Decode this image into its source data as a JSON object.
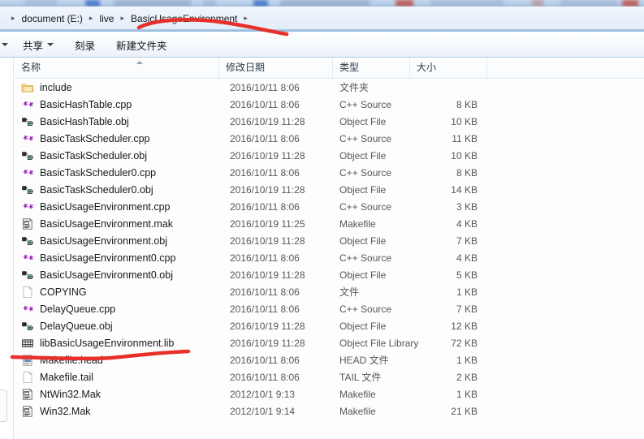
{
  "window": {
    "background_strip": "partially visible window behind"
  },
  "addressbar": {
    "crumbs": [
      "document (E:)",
      "live",
      "BasicUsageEnvironment"
    ],
    "separator": "▸",
    "trailing_separator": "▸"
  },
  "toolbar": {
    "leading_caret": "▾",
    "items": [
      {
        "label": "共享",
        "has_caret": true
      },
      {
        "label": "刻录",
        "has_caret": false
      },
      {
        "label": "新建文件夹",
        "has_caret": false
      }
    ]
  },
  "columns": {
    "name": "名称",
    "date": "修改日期",
    "type": "类型",
    "size": "大小"
  },
  "files": [
    {
      "name": "include",
      "date": "2016/10/11 8:06",
      "type": "文件夹",
      "size": "",
      "icon": "folder-icon"
    },
    {
      "name": "BasicHashTable.cpp",
      "date": "2016/10/11 8:06",
      "type": "C++ Source",
      "size": "8 KB",
      "icon": "cpp-source-icon"
    },
    {
      "name": "BasicHashTable.obj",
      "date": "2016/10/19 11:28",
      "type": "Object File",
      "size": "10 KB",
      "icon": "object-file-icon"
    },
    {
      "name": "BasicTaskScheduler.cpp",
      "date": "2016/10/11 8:06",
      "type": "C++ Source",
      "size": "11 KB",
      "icon": "cpp-source-icon"
    },
    {
      "name": "BasicTaskScheduler.obj",
      "date": "2016/10/19 11:28",
      "type": "Object File",
      "size": "10 KB",
      "icon": "object-file-icon"
    },
    {
      "name": "BasicTaskScheduler0.cpp",
      "date": "2016/10/11 8:06",
      "type": "C++ Source",
      "size": "8 KB",
      "icon": "cpp-source-icon"
    },
    {
      "name": "BasicTaskScheduler0.obj",
      "date": "2016/10/19 11:28",
      "type": "Object File",
      "size": "14 KB",
      "icon": "object-file-icon"
    },
    {
      "name": "BasicUsageEnvironment.cpp",
      "date": "2016/10/11 8:06",
      "type": "C++ Source",
      "size": "3 KB",
      "icon": "cpp-source-icon"
    },
    {
      "name": "BasicUsageEnvironment.mak",
      "date": "2016/10/19 11:25",
      "type": "Makefile",
      "size": "4 KB",
      "icon": "makefile-icon"
    },
    {
      "name": "BasicUsageEnvironment.obj",
      "date": "2016/10/19 11:28",
      "type": "Object File",
      "size": "7 KB",
      "icon": "object-file-icon"
    },
    {
      "name": "BasicUsageEnvironment0.cpp",
      "date": "2016/10/11 8:06",
      "type": "C++ Source",
      "size": "4 KB",
      "icon": "cpp-source-icon"
    },
    {
      "name": "BasicUsageEnvironment0.obj",
      "date": "2016/10/19 11:28",
      "type": "Object File",
      "size": "5 KB",
      "icon": "object-file-icon"
    },
    {
      "name": "COPYING",
      "date": "2016/10/11 8:06",
      "type": "文件",
      "size": "1 KB",
      "icon": "blank-file-icon"
    },
    {
      "name": "DelayQueue.cpp",
      "date": "2016/10/11 8:06",
      "type": "C++ Source",
      "size": "7 KB",
      "icon": "cpp-source-icon"
    },
    {
      "name": "DelayQueue.obj",
      "date": "2016/10/19 11:28",
      "type": "Object File",
      "size": "12 KB",
      "icon": "object-file-icon"
    },
    {
      "name": "libBasicUsageEnvironment.lib",
      "date": "2016/10/19 11:28",
      "type": "Object File Library",
      "size": "72 KB",
      "icon": "library-file-icon"
    },
    {
      "name": "Makefile.head",
      "date": "2016/10/11 8:06",
      "type": "HEAD 文件",
      "size": "1 KB",
      "icon": "head-file-icon"
    },
    {
      "name": "Makefile.tail",
      "date": "2016/10/11 8:06",
      "type": "TAIL 文件",
      "size": "2 KB",
      "icon": "blank-file-icon"
    },
    {
      "name": "NtWin32.Mak",
      "date": "2012/10/1 9:13",
      "type": "Makefile",
      "size": "1 KB",
      "icon": "makefile-icon"
    },
    {
      "name": "Win32.Mak",
      "date": "2012/10/1 9:14",
      "type": "Makefile",
      "size": "21 KB",
      "icon": "makefile-icon"
    }
  ],
  "annotations": {
    "color": "#e8302a",
    "marks": [
      {
        "target": "BasicUsageEnvironment breadcrumb"
      },
      {
        "target": "libBasicUsageEnvironment.lib row"
      }
    ]
  }
}
